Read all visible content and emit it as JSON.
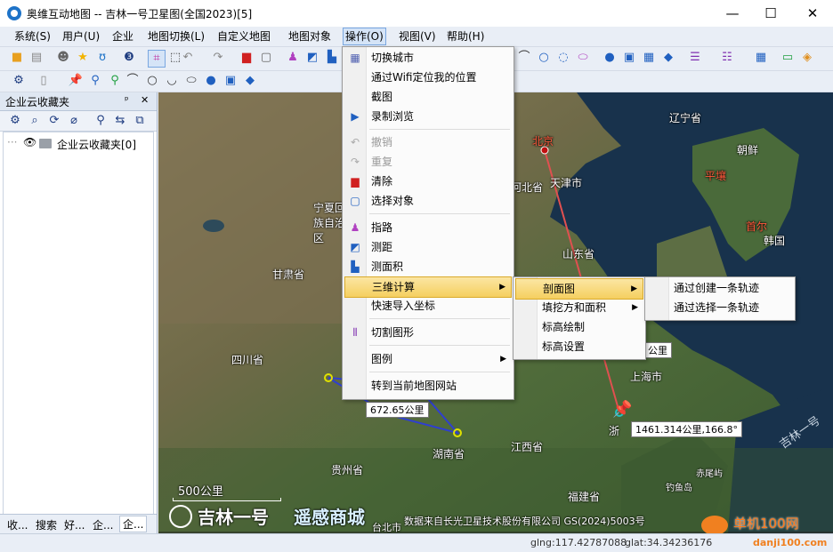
{
  "window": {
    "title": "奥维互动地图 -- 吉林一号卫星图(全国2023)[5]",
    "minimize": "—",
    "maximize": "☐",
    "close": "✕"
  },
  "menubar": [
    "系统(S)",
    "用户(U)",
    "企业",
    "地图切换(L)",
    "自定义地图",
    "地图对象",
    "操作(O)",
    "视图(V)",
    "帮助(H)"
  ],
  "left_panel": {
    "title": "企业云收藏夹",
    "pin": "ᵖ",
    "close": "✕",
    "tree_item": "企业云收藏夹[0]",
    "tabs": [
      "收...",
      "搜索",
      "好...",
      "企...",
      "企..."
    ]
  },
  "map": {
    "labels": {
      "beijing": "北京",
      "tianjin": "天津市",
      "hebei": "河北省",
      "liaoning": "辽宁省",
      "chaoxian": "朝鲜",
      "pingrang": "平壤",
      "shouer": "首尔",
      "hanguo": "韩国",
      "shandong": "山东省",
      "ningxia": "宁夏回族自治区",
      "gansu": "甘肃省",
      "sichuan": "四川省",
      "guizhou": "贵州省",
      "hunan": "湖南省",
      "jiangxi": "江西省",
      "fujian": "福建省",
      "shanghai": "上海市",
      "zhe": "浙",
      "chiwei": "赤尾屿",
      "diaoyu": "钓鱼岛",
      "taibei": "台北市",
      "jilin_watermark": "吉林一号"
    },
    "measure_1": "672.65公里",
    "measure_2": "1461.314公里,166.8°",
    "measure_3": "公里",
    "scale": "500公里",
    "brand_1": "吉林一号",
    "brand_2": "遥感商城",
    "credit": "数据来自长光卫星技术股份有限公司 GS(2024)5003号",
    "site_watermark": "单机100网",
    "site_url": "danji100.com"
  },
  "status": {
    "lng": "glng:117.42787088",
    "lat": "glat:34.34236176"
  },
  "operation_menu": {
    "items": [
      {
        "label": "切换城市",
        "icon": "city-icon",
        "disabled": false
      },
      {
        "label": "通过Wifi定位我的位置",
        "icon": "",
        "disabled": false
      },
      {
        "label": "截图",
        "icon": "",
        "disabled": false
      },
      {
        "label": "录制浏览",
        "icon": "video-icon",
        "disabled": false
      },
      {
        "label": "撤销",
        "icon": "undo-icon",
        "disabled": true
      },
      {
        "label": "重复",
        "icon": "redo-icon",
        "disabled": true
      },
      {
        "label": "清除",
        "icon": "trash-icon",
        "disabled": false
      },
      {
        "label": "选择对象",
        "icon": "select-icon",
        "disabled": false
      },
      {
        "label": "指路",
        "icon": "route-icon",
        "disabled": false
      },
      {
        "label": "测距",
        "icon": "ruler-icon",
        "disabled": false
      },
      {
        "label": "测面积",
        "icon": "area-icon",
        "disabled": false
      },
      {
        "label": "三维计算",
        "icon": "",
        "disabled": false
      },
      {
        "label": "快速导入坐标",
        "icon": "",
        "disabled": false
      },
      {
        "label": "切割图形",
        "icon": "cut-icon",
        "disabled": false
      },
      {
        "label": "图例",
        "icon": "",
        "disabled": false
      },
      {
        "label": "转到当前地图网站",
        "icon": "",
        "disabled": false
      }
    ]
  },
  "sub_menu_3d": [
    "剖面图",
    "填挖方和面积",
    "标高绘制",
    "标高设置"
  ],
  "sub_menu_profile": [
    "通过创建一条轨迹",
    "通过选择一条轨迹"
  ],
  "colors": {
    "accent": "#1e73c8",
    "highlight": "#f5cf5f",
    "route": "#e05050",
    "measure_line": "#2f3fd0"
  }
}
